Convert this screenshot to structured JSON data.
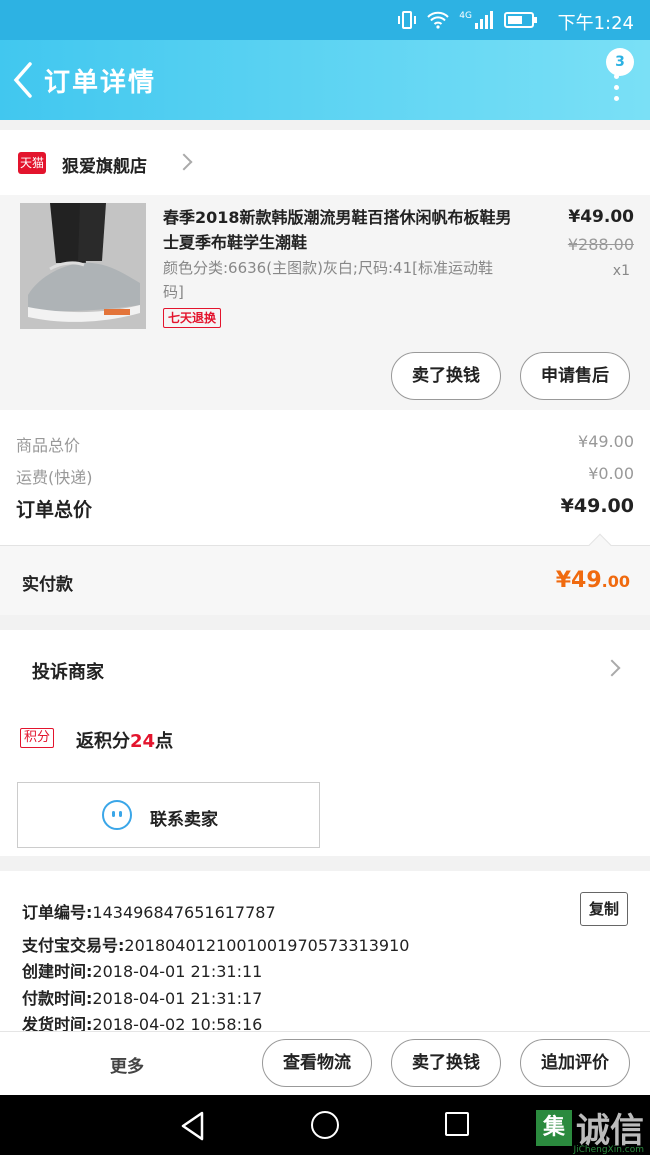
{
  "status": {
    "time": "下午1:24",
    "network": "4G"
  },
  "header": {
    "title": "订单详情",
    "badge": "3"
  },
  "shop": {
    "platform_badge": "天猫",
    "name": "狠爱旗舰店"
  },
  "product": {
    "title": "春季2018新款韩版潮流男鞋百搭休闲帆布板鞋男士夏季布鞋学生潮鞋",
    "spec": "颜色分类:6636(主图款)灰白;尺码:41[标准运动鞋码]",
    "tag": "七天退换",
    "price": "¥49.00",
    "original_price": "¥288.00",
    "quantity": "x1",
    "btn_exchange": "卖了换钱",
    "btn_aftersale": "申请售后"
  },
  "summary": {
    "goods_label": "商品总价",
    "goods_value": "¥49.00",
    "shipping_label": "运费(快递)",
    "shipping_value": "¥0.00",
    "total_label": "订单总价",
    "total_value": "¥49.00",
    "paid_label": "实付款",
    "paid_yuan": "¥49",
    "paid_cents": ".00"
  },
  "complain": {
    "label": "投诉商家"
  },
  "points": {
    "badge": "积分",
    "prefix": "返积分",
    "count": "24",
    "suffix": "点"
  },
  "contact": {
    "label": "联系卖家"
  },
  "order_info": {
    "order_no_label": "订单编号:",
    "order_no": "143496847651617787",
    "copy_label": "复制",
    "alipay_label": "支付宝交易号:",
    "alipay_no": "2018040121001001970573313910",
    "created_label": "创建时间:",
    "created": "2018-04-01 21:31:11",
    "paid_time_label": "付款时间:",
    "paid_time": "2018-04-01 21:31:17",
    "ship_label": "发货时间:",
    "ship_time": "2018-04-02 10:58:16"
  },
  "bottom": {
    "more": "更多",
    "logistics": "查看物流",
    "sell": "卖了换钱",
    "review": "追加评价"
  },
  "watermark": {
    "mark": "集",
    "text": "诚信",
    "url": "JiChengXin.com"
  }
}
